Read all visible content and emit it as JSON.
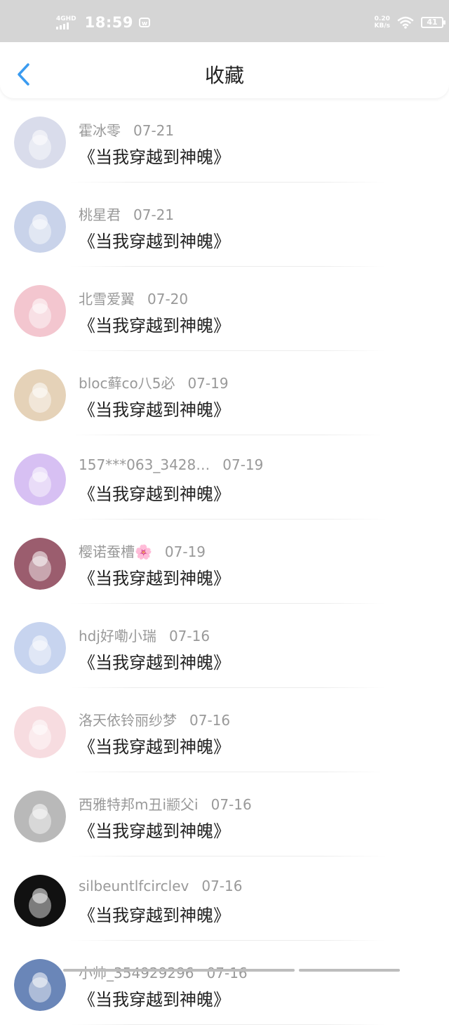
{
  "status_bar": {
    "network": "4GHD",
    "time": "18:59",
    "speed_value": "0.20",
    "speed_unit": "KB/s",
    "battery": "41",
    "wifi_icon": "wifi-icon"
  },
  "header": {
    "title": "收藏",
    "back_icon": "chevron-left-icon"
  },
  "colors": {
    "accent": "#3a9bf0",
    "status_bar_bg": "#d5d5d5",
    "meta_text": "#999999",
    "title_text": "#222222"
  },
  "items": [
    {
      "user": "霍冰零",
      "date": "07-21",
      "book": "《当我穿越到神魄》",
      "avatar_color": "#d9dceb"
    },
    {
      "user": "桃星君",
      "date": "07-21",
      "book": "《当我穿越到神魄》",
      "avatar_color": "#c9d3ea"
    },
    {
      "user": "北雪爱翼",
      "date": "07-20",
      "book": "《当我穿越到神魄》",
      "avatar_color": "#f3c6cf"
    },
    {
      "user": "bloc藓co八5必",
      "date": "07-19",
      "book": "《当我穿越到神魄》",
      "avatar_color": "#e5d2b8"
    },
    {
      "user": "157***063_3428…",
      "date": "07-19",
      "book": "《当我穿越到神魄》",
      "avatar_color": "#d7c0f3"
    },
    {
      "user": "樱诺蚕槽🌸",
      "date": "07-19",
      "book": "《当我穿越到神魄》",
      "avatar_color": "#9b5d6e"
    },
    {
      "user": "hdj好嘞小瑞",
      "date": "07-16",
      "book": "《当我穿越到神魄》",
      "avatar_color": "#c7d4ef"
    },
    {
      "user": "洛天依铃丽纱梦",
      "date": "07-16",
      "book": "《当我穿越到神魄》",
      "avatar_color": "#f7dce0"
    },
    {
      "user": "西雅特邦m丑i颛父i",
      "date": "07-16",
      "book": "《当我穿越到神魄》",
      "avatar_color": "#b9b9b9"
    },
    {
      "user": "silbeuntlfcirclev",
      "date": "07-16",
      "book": "《当我穿越到神魄》",
      "avatar_color": "#111111"
    },
    {
      "user": "小帅_354929296",
      "date": "07-16",
      "book": "《当我穿越到神魄》",
      "avatar_color": "#6a86b8"
    }
  ]
}
